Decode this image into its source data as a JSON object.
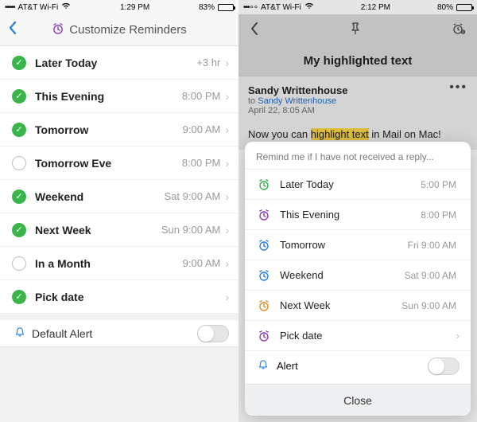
{
  "left": {
    "status": {
      "carrier": "AT&T Wi-Fi",
      "time": "1:29 PM",
      "battery_pct": "83%",
      "battery_fill": "83%"
    },
    "nav": {
      "title": "Customize Reminders"
    },
    "rows": [
      {
        "label": "Later Today",
        "value": "+3 hr",
        "checked": true
      },
      {
        "label": "This Evening",
        "value": "8:00 PM",
        "checked": true
      },
      {
        "label": "Tomorrow",
        "value": "9:00 AM",
        "checked": true
      },
      {
        "label": "Tomorrow Eve",
        "value": "8:00 PM",
        "checked": false
      },
      {
        "label": "Weekend",
        "value": "Sat 9:00 AM",
        "checked": true
      },
      {
        "label": "Next Week",
        "value": "Sun 9:00 AM",
        "checked": true
      },
      {
        "label": "In a Month",
        "value": "9:00 AM",
        "checked": false
      },
      {
        "label": "Pick date",
        "value": "",
        "checked": true
      }
    ],
    "alert_label": "Default Alert"
  },
  "right": {
    "status": {
      "carrier": "AT&T Wi-Fi",
      "time": "2:12 PM",
      "battery_pct": "80%",
      "battery_fill": "80%"
    },
    "folder": "My highlighted text",
    "msg": {
      "from": "Sandy Writtenhouse",
      "to_prefix": "to ",
      "to": "Sandy Writtenhouse",
      "date": "April 22, 8:05 AM",
      "body_pre": "Now you can ",
      "body_hl": "highlight text",
      "body_post": " in Mail on Mac!"
    },
    "sheet": {
      "title": "Remind me if I have not received a reply...",
      "rows": [
        {
          "label": "Later Today",
          "value": "5:00 PM",
          "color": "green",
          "chev": false
        },
        {
          "label": "This Evening",
          "value": "8:00 PM",
          "color": "purple",
          "chev": false
        },
        {
          "label": "Tomorrow",
          "value": "Fri 9:00 AM",
          "color": "blue",
          "chev": false
        },
        {
          "label": "Weekend",
          "value": "Sat 9:00 AM",
          "color": "blue",
          "chev": false
        },
        {
          "label": "Next Week",
          "value": "Sun 9:00 AM",
          "color": "orange",
          "chev": false
        },
        {
          "label": "Pick date",
          "value": "",
          "color": "purple",
          "chev": true
        }
      ],
      "alert_label": "Alert",
      "close": "Close"
    }
  }
}
